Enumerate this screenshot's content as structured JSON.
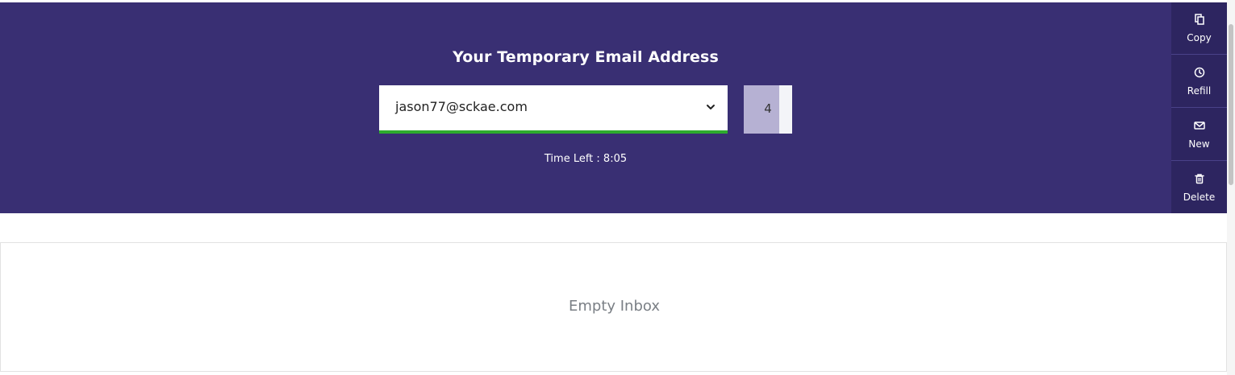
{
  "hero": {
    "title": "Your Temporary Email Address",
    "email": "jason77@sckae.com",
    "count": "4",
    "timer": "Time Left : 8:05"
  },
  "actions": [
    {
      "label": "Copy",
      "icon": "copy-icon"
    },
    {
      "label": "Refill",
      "icon": "clock-icon"
    },
    {
      "label": "New",
      "icon": "envelope-icon"
    },
    {
      "label": "Delete",
      "icon": "trash-icon"
    }
  ],
  "inbox": {
    "empty_text": "Empty Inbox"
  },
  "colors": {
    "hero_bg": "#392f73",
    "side_bg": "#2d2560",
    "accent_green": "#2eac2e",
    "count_bg": "#b6b1d3"
  }
}
